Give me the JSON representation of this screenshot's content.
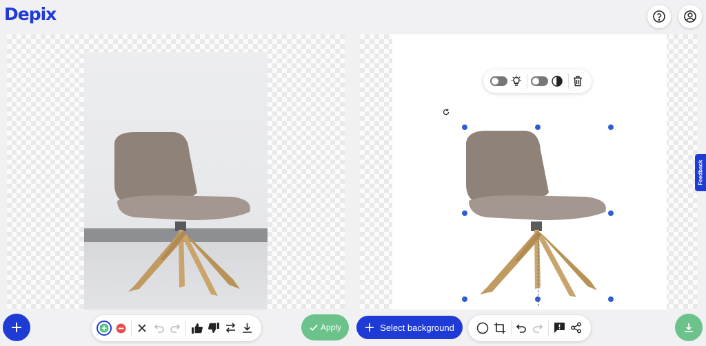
{
  "app": {
    "logo_text": "Depix"
  },
  "header": {
    "help_icon": "question-circle-icon",
    "account_icon": "user-circle-icon"
  },
  "feedback": {
    "label": "Feedback"
  },
  "left_toolbar": {
    "icons": [
      "brush-add-icon",
      "brush-erase-icon",
      "close-icon",
      "undo-icon",
      "redo-icon",
      "thumbs-up-icon",
      "thumbs-down-icon",
      "swap-icon",
      "download-icon"
    ],
    "apply_label": "Apply"
  },
  "right_toolbar": {
    "select_background_label": "Select background",
    "icons": [
      "circle-shape-icon",
      "crop-icon",
      "undo-icon",
      "redo-icon",
      "report-icon",
      "share-icon"
    ]
  },
  "floating_tools": {
    "icons": [
      "toggle-light",
      "lightbulb-icon",
      "toggle-contrast",
      "contrast-icon",
      "trash-icon"
    ]
  },
  "colors": {
    "brand": "#1f3bd6",
    "apply": "#6cc28b",
    "select_handle": "#2d5fd3"
  }
}
